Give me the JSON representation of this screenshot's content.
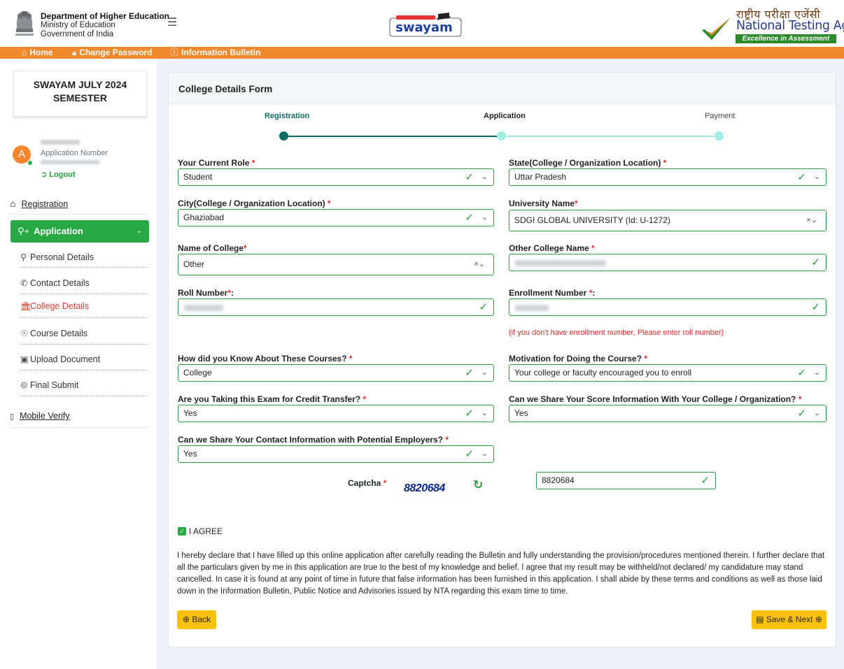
{
  "header": {
    "dept_title": "Department of Higher Education",
    "dept_ministry": "Ministry of Education",
    "dept_govt": "Government of India",
    "swayam_logo_text": "swayam",
    "nta_hindi": "राष्ट्रीय परीक्षा एजेंसी",
    "nta_english": "National Testing Agency",
    "nta_tagline": "Excellence in Assessment"
  },
  "topnav": {
    "home": "Home",
    "change_password": "Change Password",
    "info_bulletin": "Information Bulletin"
  },
  "sidebar": {
    "semester_title": "SWAYAM JULY 2024 SEMESTER",
    "avatar_letter": "A",
    "app_number_label": "Application Number",
    "logout": "Logout",
    "registration": "Registration",
    "application": "Application",
    "sub_items": [
      "Personal Details",
      "Contact Details",
      "College Details",
      "Course Details",
      "Upload Document",
      "Final Submit"
    ],
    "mobile_verify": "Mobile Verify"
  },
  "form": {
    "title": "College Details Form",
    "steps": [
      "Registration",
      "Application",
      "Payment"
    ],
    "current_role_label": "Your Current Role",
    "current_role": "Student",
    "state_label": "State(College / Organization Location)",
    "state": "Uttar Pradesh",
    "city_label": "City(College / Organization Location)",
    "city": "Ghaziabad",
    "university_label": "University Name",
    "university": "SDGI GLOBAL UNIVERSITY (Id: U-1272)",
    "college_label": "Name of College",
    "college": "Other",
    "other_college_label": "Other College Name",
    "roll_label": "Roll Number",
    "roll_suffix": ":",
    "enroll_label": "Enrollment Number",
    "enroll_suffix": ":",
    "enroll_hint": "(if you don't have enrollment number, Please enter roll number)",
    "know_label": "How did you Know About These Courses?",
    "know": "College",
    "motivation_label": "Motivation for Doing the Course?",
    "motivation": "Your college or faculty encouraged you to enroll",
    "credit_label": "Are you Taking this Exam for Credit Transfer?",
    "credit": "Yes",
    "share_score_label": "Can we Share Your Score Information With Your College / Organization?",
    "share_score": "Yes",
    "share_contact_label": "Can we Share Your Contact Information with Potential Employers?",
    "share_contact": "Yes",
    "captcha_label": "Captcha",
    "captcha_image_text": "8820684",
    "captcha_value": "8820684",
    "agree_label": "I AGREE",
    "declaration": "I hereby declare that I have filled up this online application after carefully reading the Bulletin and fully understanding the provision/procedures mentioned therein. I further declare that all the particulars given by me in this application are true to the best of my knowledge and belief. I agree that my result may be withheld/not declared/ my candidature may stand cancelled. In case it is found at any point of time in future that false information has been furnished in this application. I shall abide by these terms and conditions as well as those laid down in the Information Bulletin, Public Notice and Advisories issued by NTA regarding this exam time to time.",
    "back": "Back",
    "save_next": "Save & Next"
  },
  "colors": {
    "orange_nav": "#f0892e",
    "green": "#28a745",
    "step_active": "#0f6b62",
    "step_pending": "#a3ece4",
    "button_yellow": "#ffc107",
    "required_red": "#e0282e"
  }
}
